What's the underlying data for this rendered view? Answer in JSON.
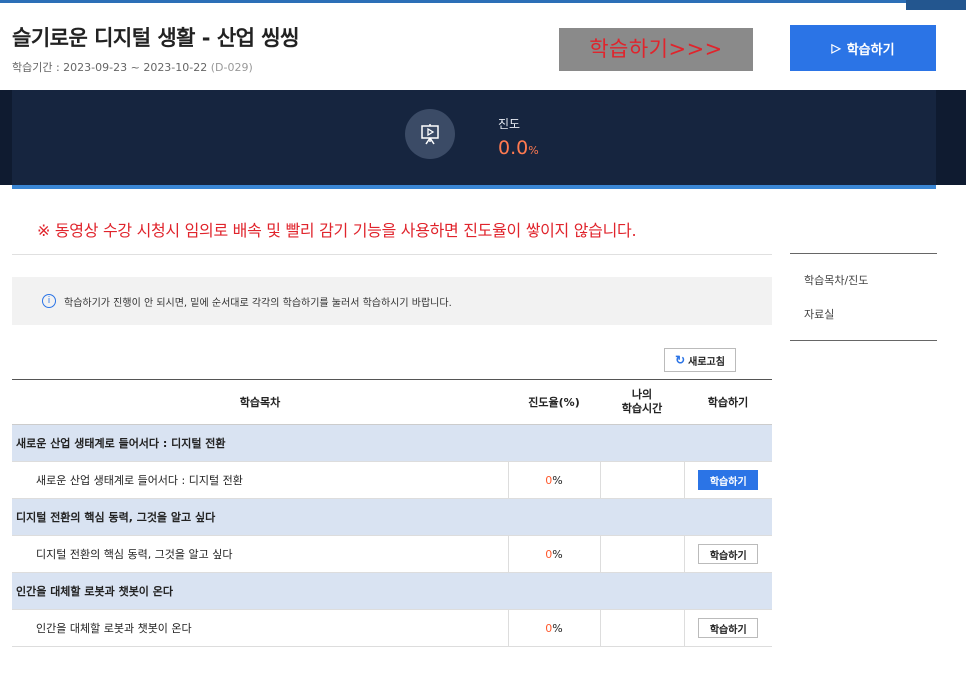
{
  "course": {
    "title": "슬기로운 디지털 생활 - 산업 씽씽",
    "period": "학습기간 : 2023-09-23 ~ 2023-10-22",
    "dday": "(D-029)"
  },
  "banner": {
    "text": "학습하기>>>"
  },
  "top_button": {
    "label": "학습하기",
    "icon": "play-triangle-icon"
  },
  "progress": {
    "label": "진도",
    "value": "0.0",
    "unit": "%",
    "icon": "presentation-board-icon"
  },
  "warning": "※ 동영상 수강 시청시 임의로 배속 및 빨리 감기 기능을 사용하면 진도율이 쌓이지 않습니다.",
  "notice": {
    "icon": "info-icon",
    "text": "학습하기가 진행이 안 되시면, 밑에 순서대로 각각의 학습하기를 눌러서 학습하시기 바랍니다."
  },
  "refresh": {
    "label": "새로고침",
    "icon": "refresh-icon"
  },
  "side_menu": {
    "items": [
      "학습목차/진도",
      "자료실"
    ]
  },
  "table": {
    "headers": {
      "title": "학습목차",
      "rate": "진도율(%)",
      "time_line1": "나의",
      "time_line2": "학습시간",
      "action": "학습하기"
    },
    "chapters": [
      {
        "title": "새로운 산업 생태계로 들어서다 : 디지털 전환",
        "lesson": "새로운 산업 생태계로 들어서다 : 디지털 전환",
        "rate": "0",
        "unit": "%",
        "button": "학습하기",
        "active": true
      },
      {
        "title": "디지털 전환의 핵심 동력, 그것을 알고 싶다",
        "lesson": "디지털 전환의 핵심 동력, 그것을 알고 싶다",
        "rate": "0",
        "unit": "%",
        "button": "학습하기",
        "active": false
      },
      {
        "title": "인간을 대체할 로봇과 챗봇이 온다",
        "lesson": "인간을 대체할 로봇과 챗봇이 온다",
        "rate": "0",
        "unit": "%",
        "button": "학습하기",
        "active": false
      }
    ]
  }
}
